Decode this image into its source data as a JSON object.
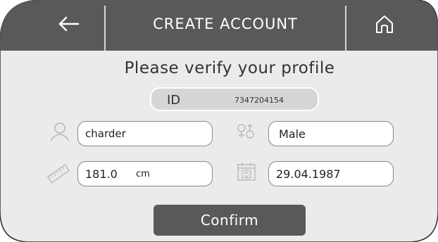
{
  "header": {
    "title": "CREATE  ACCOUNT",
    "back_icon": "back-arrow-icon",
    "home_icon": "home-icon"
  },
  "main": {
    "title": "Please verify your profile",
    "id": {
      "label": "ID",
      "value": "7347204154"
    },
    "fields": {
      "username": {
        "value": "charder",
        "icon": "user-icon"
      },
      "gender": {
        "value": "Male",
        "icon": "gender-icon"
      },
      "height": {
        "value": "181.0",
        "unit": "cm",
        "icon": "ruler-icon"
      },
      "birthdate": {
        "value": "29.04.1987",
        "icon": "calendar-icon"
      }
    },
    "confirm_label": "Confirm"
  },
  "colors": {
    "header_bg": "#595959",
    "body_bg": "#ebebeb",
    "button_bg": "#595959",
    "pill_bg": "#d6d6d6",
    "icon_gray": "#bdbdbd"
  }
}
